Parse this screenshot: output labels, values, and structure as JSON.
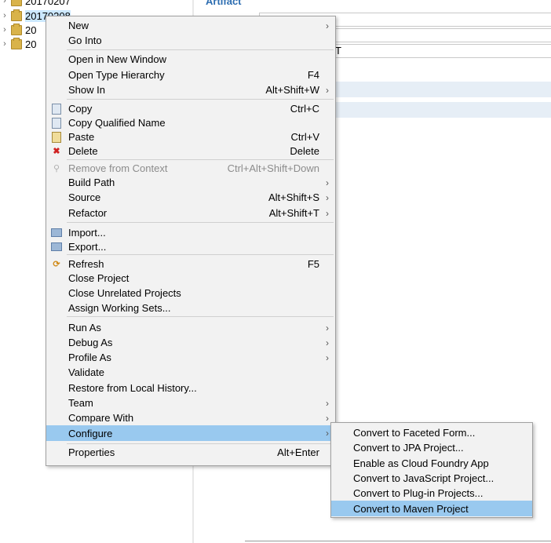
{
  "explorer": {
    "items": [
      {
        "label": "20170207",
        "selected": false
      },
      {
        "label": "20170208",
        "selected": true
      },
      {
        "label": "20",
        "selected": false
      },
      {
        "label": "20",
        "selected": false
      }
    ]
  },
  "editor": {
    "section_title": "Artifact",
    "field_text": "T"
  },
  "context_menu": {
    "items": [
      {
        "label": "New",
        "shortcut": "",
        "submenu": true
      },
      {
        "label": "Go Into",
        "shortcut": "",
        "submenu": false
      },
      {
        "label": "Open in New Window",
        "shortcut": "",
        "submenu": false
      },
      {
        "label": "Open Type Hierarchy",
        "shortcut": "F4",
        "submenu": false
      },
      {
        "label": "Show In",
        "shortcut": "Alt+Shift+W",
        "submenu": true
      },
      {
        "label": "Copy",
        "shortcut": "Ctrl+C",
        "submenu": false,
        "icon": "copy-icon"
      },
      {
        "label": "Copy Qualified Name",
        "shortcut": "",
        "submenu": false,
        "icon": "copy-qualified-name-icon"
      },
      {
        "label": "Paste",
        "shortcut": "Ctrl+V",
        "submenu": false,
        "icon": "paste-icon"
      },
      {
        "label": "Delete",
        "shortcut": "Delete",
        "submenu": false,
        "icon": "delete-icon"
      },
      {
        "label": "Remove from Context",
        "shortcut": "Ctrl+Alt+Shift+Down",
        "submenu": false,
        "disabled": true,
        "icon": "remove-from-context-icon"
      },
      {
        "label": "Build Path",
        "shortcut": "",
        "submenu": true
      },
      {
        "label": "Source",
        "shortcut": "Alt+Shift+S",
        "submenu": true
      },
      {
        "label": "Refactor",
        "shortcut": "Alt+Shift+T",
        "submenu": true
      },
      {
        "label": "Import...",
        "shortcut": "",
        "submenu": false,
        "icon": "import-icon"
      },
      {
        "label": "Export...",
        "shortcut": "",
        "submenu": false,
        "icon": "export-icon"
      },
      {
        "label": "Refresh",
        "shortcut": "F5",
        "submenu": false,
        "icon": "refresh-icon"
      },
      {
        "label": "Close Project",
        "shortcut": "",
        "submenu": false
      },
      {
        "label": "Close Unrelated Projects",
        "shortcut": "",
        "submenu": false
      },
      {
        "label": "Assign Working Sets...",
        "shortcut": "",
        "submenu": false
      },
      {
        "label": "Run As",
        "shortcut": "",
        "submenu": true
      },
      {
        "label": "Debug As",
        "shortcut": "",
        "submenu": true
      },
      {
        "label": "Profile As",
        "shortcut": "",
        "submenu": true
      },
      {
        "label": "Validate",
        "shortcut": "",
        "submenu": false
      },
      {
        "label": "Restore from Local History...",
        "shortcut": "",
        "submenu": false
      },
      {
        "label": "Team",
        "shortcut": "",
        "submenu": true
      },
      {
        "label": "Compare With",
        "shortcut": "",
        "submenu": true
      },
      {
        "label": "Configure",
        "shortcut": "",
        "submenu": true,
        "highlighted": true
      },
      {
        "label": "Properties",
        "shortcut": "Alt+Enter",
        "submenu": false
      }
    ],
    "submenu_arrow": "›"
  },
  "configure_submenu": {
    "items": [
      {
        "label": "Convert to Faceted Form..."
      },
      {
        "label": "Convert to JPA Project..."
      },
      {
        "label": "Enable as Cloud Foundry App"
      },
      {
        "label": "Convert to JavaScript Project..."
      },
      {
        "label": "Convert to Plug-in Projects..."
      },
      {
        "label": "Convert to Maven Project",
        "highlighted": true
      }
    ]
  },
  "colors": {
    "menu_background": "#f2f2f2",
    "highlight": "#99c9ef",
    "selection": "#cce8ff"
  }
}
